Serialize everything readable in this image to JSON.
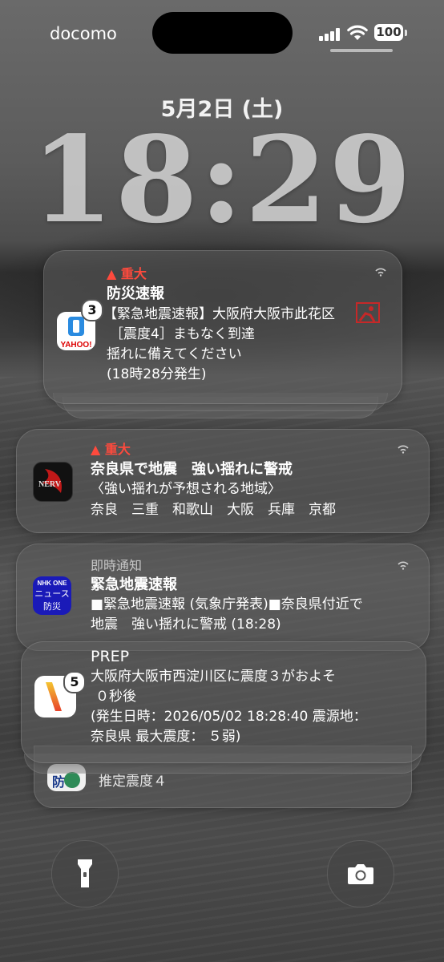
{
  "status_bar": {
    "carrier": "docomo",
    "battery": "100"
  },
  "lock": {
    "date": "5月2日 (土)",
    "time": "18:29"
  },
  "notifications": [
    {
      "app": "Yahoo! JAPAN 防災速報",
      "badge": "3",
      "priority": "重大",
      "title": "防災速報",
      "lines": [
        "【緊急地震速報】大阪府大阪市此花区",
        "［震度4］まもなく到達",
        "揺れに備えてください",
        "(18時28分発生)"
      ]
    },
    {
      "app": "NERV",
      "priority": "重大",
      "title": "奈良県で地震　強い揺れに警戒",
      "lines": [
        "〈強い揺れが予想される地域〉",
        "奈良　三重　和歌山　大阪　兵庫　京都"
      ]
    },
    {
      "app": "NHK ONE ニュース・防災",
      "icon_text": [
        "NHK ONE",
        "ニュース",
        "防災"
      ],
      "priority": "即時通知",
      "title": "緊急地震速報",
      "lines": [
        "■緊急地震速報 (気象庁発表)■奈良県付近で",
        "地震　強い揺れに警戒 (18:28)"
      ]
    },
    {
      "app": "PREP",
      "badge": "5",
      "title": "PREP",
      "lines": [
        "大阪府大阪市西淀川区に震度３がおよそ",
        "０秒後",
        "(発生日時：2026/05/02 18:28:40 震源地：",
        "奈良県 最大震度： ５弱)"
      ]
    },
    {
      "app": "防災アプリ",
      "peek": "推定震度４"
    }
  ],
  "colors": {
    "alert": "#ff4a3d",
    "nhk_blue": "#1a1ab8"
  }
}
